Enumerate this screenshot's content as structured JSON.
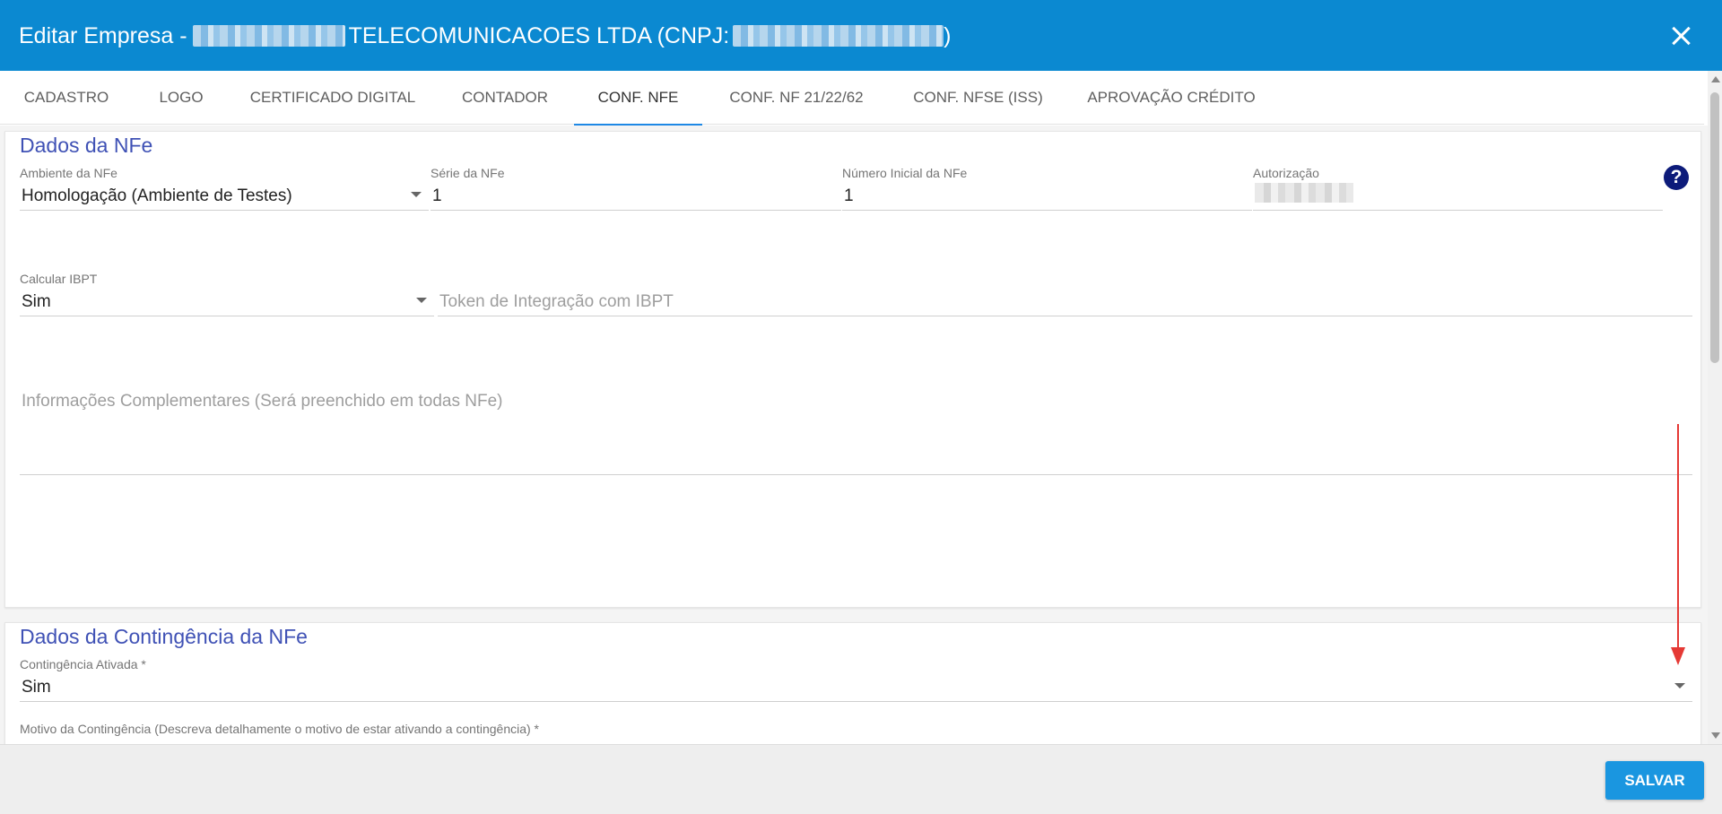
{
  "header": {
    "title_prefix": "Editar Empresa - ",
    "title_company": "TELECOMUNICACOES LTDA (CNPJ: ",
    "title_suffix": ")",
    "background": "#0b89d1"
  },
  "tabs": [
    {
      "label": "CADASTRO",
      "active": false
    },
    {
      "label": "LOGO",
      "active": false
    },
    {
      "label": "CERTIFICADO DIGITAL",
      "active": false
    },
    {
      "label": "CONTADOR",
      "active": false
    },
    {
      "label": "CONF. NFE",
      "active": true
    },
    {
      "label": "CONF. NF 21/22/62",
      "active": false
    },
    {
      "label": "CONF. NFSE (ISS)",
      "active": false
    },
    {
      "label": "APROVAÇÃO CRÉDITO",
      "active": false
    }
  ],
  "nfe_section": {
    "title": "Dados da NFe",
    "ambiente": {
      "label": "Ambiente da NFe",
      "value": "Homologação (Ambiente de Testes)"
    },
    "serie": {
      "label": "Série da NFe",
      "value": "1"
    },
    "numero_inicial": {
      "label": "Número Inicial da NFe",
      "value": "1"
    },
    "autorizacao": {
      "label": "Autorização"
    },
    "calcular_ibpt": {
      "label": "Calcular IBPT",
      "value": "Sim"
    },
    "token_ibpt": {
      "placeholder": "Token de Integração com IBPT"
    },
    "info_complementares": {
      "placeholder": "Informações Complementares (Será preenchido em todas NFe)"
    }
  },
  "contingencia_section": {
    "title": "Dados da Contingência da NFe",
    "ativada": {
      "label": "Contingência Ativada *",
      "value": "Sim"
    },
    "motivo": {
      "label": "Motivo da Contingência (Descreva detalhamente o motivo de estar ativando a contingência) *"
    }
  },
  "footer": {
    "save_label": "SALVAR"
  },
  "colors": {
    "accent": "#1e88e5",
    "section_title": "#3f51b5",
    "annotation_arrow": "#e53935"
  }
}
